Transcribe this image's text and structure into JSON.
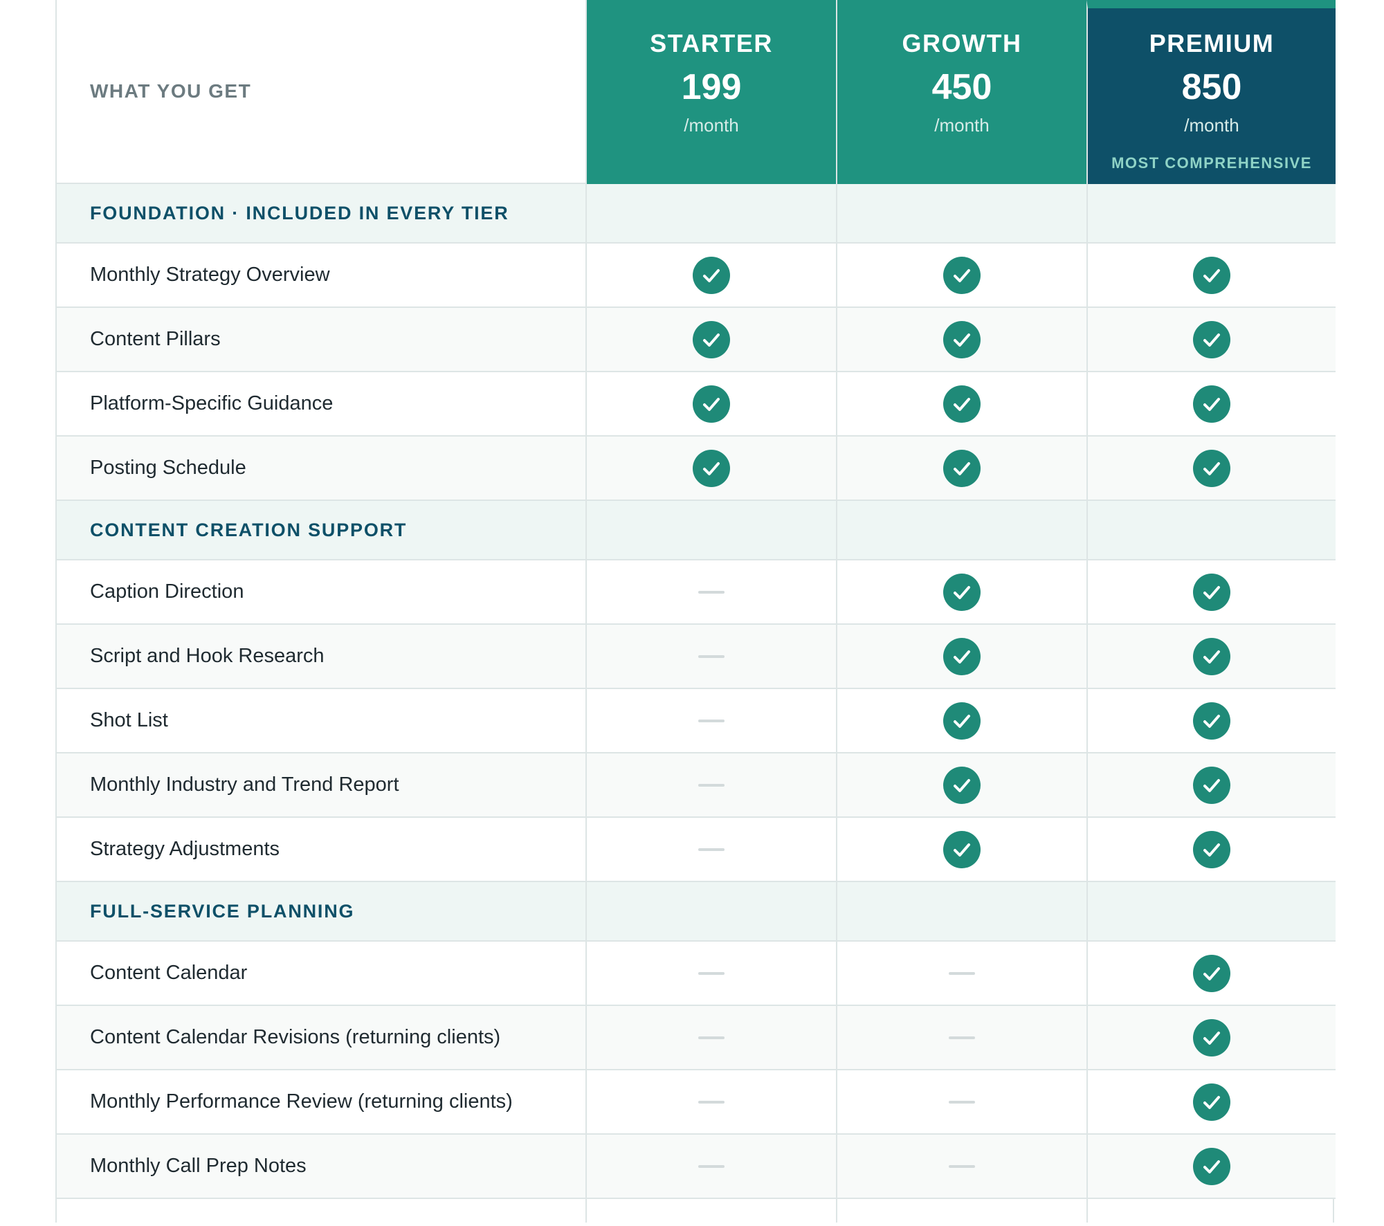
{
  "header": {
    "what_you_get": "WHAT YOU GET",
    "tiers": [
      {
        "name": "STARTER",
        "price": "199",
        "period": "/month",
        "badge": ""
      },
      {
        "name": "GROWTH",
        "price": "450",
        "period": "/month",
        "badge": ""
      },
      {
        "name": "PREMIUM",
        "price": "850",
        "period": "/month",
        "badge": "MOST COMPREHENSIVE"
      }
    ]
  },
  "colors": {
    "teal": "#1f9380",
    "navy": "#0e5068",
    "check": "#1f8a78",
    "section_bg": "#eef6f4"
  },
  "sections": [
    {
      "title": "FOUNDATION · INCLUDED IN EVERY TIER",
      "features": [
        {
          "label": "Monthly Strategy Overview",
          "tiers": [
            true,
            true,
            true
          ]
        },
        {
          "label": "Content Pillars",
          "tiers": [
            true,
            true,
            true
          ]
        },
        {
          "label": "Platform-Specific Guidance",
          "tiers": [
            true,
            true,
            true
          ]
        },
        {
          "label": "Posting Schedule",
          "tiers": [
            true,
            true,
            true
          ]
        }
      ]
    },
    {
      "title": "CONTENT CREATION SUPPORT",
      "features": [
        {
          "label": "Caption Direction",
          "tiers": [
            false,
            true,
            true
          ]
        },
        {
          "label": "Script and Hook Research",
          "tiers": [
            false,
            true,
            true
          ]
        },
        {
          "label": "Shot List",
          "tiers": [
            false,
            true,
            true
          ]
        },
        {
          "label": "Monthly Industry and Trend Report",
          "tiers": [
            false,
            true,
            true
          ]
        },
        {
          "label": "Strategy Adjustments",
          "tiers": [
            false,
            true,
            true
          ]
        }
      ]
    },
    {
      "title": "FULL-SERVICE PLANNING",
      "features": [
        {
          "label": "Content Calendar",
          "tiers": [
            false,
            false,
            true
          ]
        },
        {
          "label": "Content Calendar Revisions (returning clients)",
          "tiers": [
            false,
            false,
            true
          ]
        },
        {
          "label": "Monthly Performance Review (returning clients)",
          "tiers": [
            false,
            false,
            true
          ]
        },
        {
          "label": "Monthly Call Prep Notes",
          "tiers": [
            false,
            false,
            true
          ]
        }
      ]
    }
  ]
}
